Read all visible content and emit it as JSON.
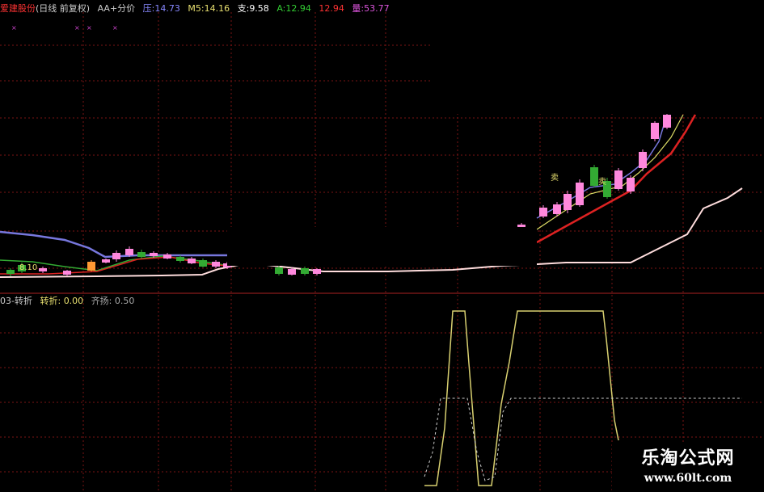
{
  "main_panel": {
    "stock_name": "爱建股份",
    "period": "(日线 前复权)",
    "indicator": "AA+分价",
    "values": [
      {
        "label": "压:",
        "value": "14.73",
        "color": "#8888ff"
      },
      {
        "label": "M5:",
        "value": "14.16",
        "color": "#e8e070"
      },
      {
        "label": "支:",
        "value": "9.58",
        "color": "#ffffff"
      },
      {
        "label": "A:",
        "value": "12.94",
        "color": "#33cc33"
      },
      {
        "label": "",
        "value": "12.94",
        "color": "#ff3333"
      },
      {
        "label": "量:",
        "value": "53.77",
        "color": "#dd55dd"
      }
    ],
    "annotations": [
      "8.10",
      "卖",
      "卖"
    ],
    "colors": {
      "up_candle": "#ff88dd",
      "down_candle": "#33aa33",
      "orange_candle": "#ff9933",
      "resistance": "#7777dd",
      "support": "#ffdddd",
      "red_ma": "#dd2222",
      "yellow_ma": "#dddd66"
    }
  },
  "sub_panel": {
    "name": "03-转折",
    "values": [
      {
        "label": "转折:",
        "value": "0.00",
        "color": "#e8e070"
      },
      {
        "label": "齐扬:",
        "value": "0.50",
        "color": "#aaaaaa"
      }
    ],
    "colors": {
      "turn_line": "#d8d070",
      "rise_line": "#cccccc"
    }
  },
  "watermark": {
    "title": "乐淘公式网",
    "url": "www.60lt.com"
  }
}
